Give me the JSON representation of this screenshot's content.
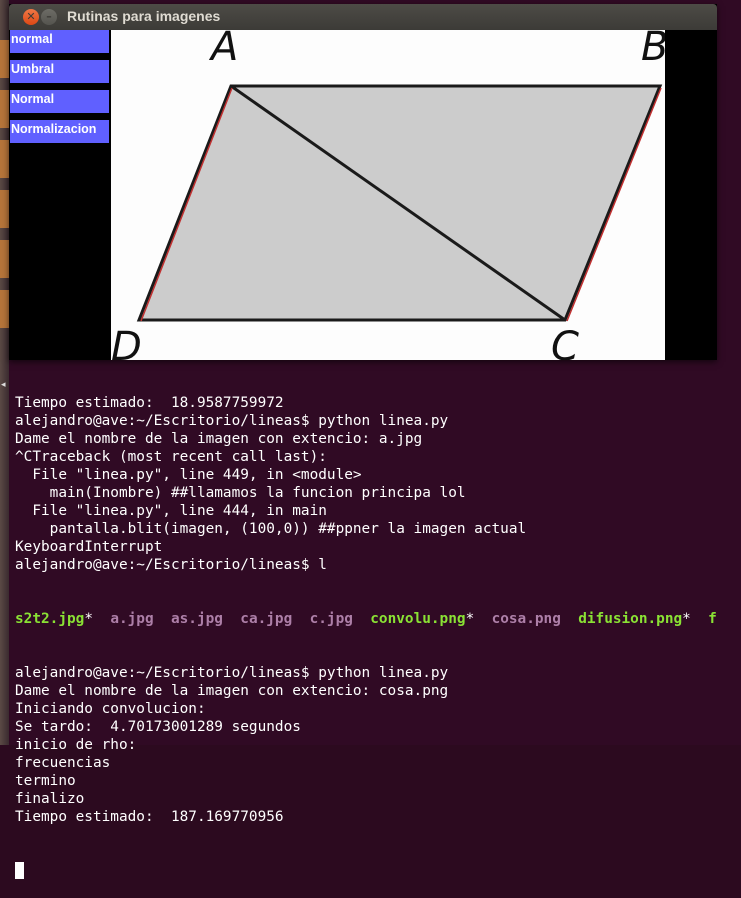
{
  "window": {
    "title": "Rutinas para imagenes",
    "close_glyph": "✕",
    "minimize_glyph": "–"
  },
  "menu": {
    "items": [
      {
        "label": "normal"
      },
      {
        "label": "Umbral"
      },
      {
        "label": "Normal"
      },
      {
        "label": "Normalizacion"
      }
    ]
  },
  "image": {
    "vertex_labels": {
      "a": "A",
      "b": "B",
      "c": "C",
      "d": "D"
    },
    "fill_color": "#cccccc",
    "edge_color": "#1a1a1a"
  },
  "terminal": {
    "lines": [
      "Tiempo estimado:  18.9587759972",
      "alejandro@ave:~/Escritorio/lineas$ python linea.py",
      "Dame el nombre de la imagen con extencio: a.jpg",
      "^CTraceback (most recent call last):",
      "  File \"linea.py\", line 449, in <module>",
      "    main(Inombre) ##llamamos la funcion principa lol",
      "  File \"linea.py\", line 444, in main",
      "    pantalla.blit(imagen, (100,0)) ##ppner la imagen actual",
      "KeyboardInterrupt",
      "alejandro@ave:~/Escritorio/lineas$ l"
    ],
    "ls_files": [
      {
        "name": "s2t2.jpg",
        "suffix": "*",
        "kind": "exe"
      },
      {
        "name": "a.jpg",
        "suffix": "",
        "kind": "img"
      },
      {
        "name": "as.jpg",
        "suffix": "",
        "kind": "img"
      },
      {
        "name": "ca.jpg",
        "suffix": "",
        "kind": "img"
      },
      {
        "name": "c.jpg",
        "suffix": "",
        "kind": "img"
      },
      {
        "name": "convolu.png",
        "suffix": "*",
        "kind": "exe"
      },
      {
        "name": "cosa.png",
        "suffix": "",
        "kind": "img"
      },
      {
        "name": "difusion.png",
        "suffix": "*",
        "kind": "exe"
      },
      {
        "name": "f",
        "suffix": "",
        "kind": "exe"
      }
    ],
    "lines_after": [
      "alejandro@ave:~/Escritorio/lineas$ python linea.py",
      "Dame el nombre de la imagen con extencio: cosa.png",
      "Iniciando convolucion:",
      "Se tardo:  4.70173001289 segundos",
      "inicio de rho:",
      "frecuencias",
      "termino",
      "finalizo",
      "Tiempo estimado:  187.169770956"
    ]
  }
}
